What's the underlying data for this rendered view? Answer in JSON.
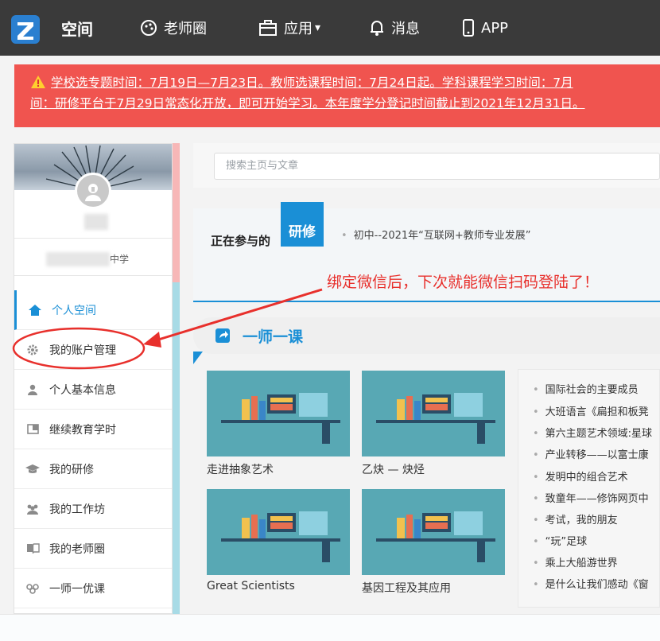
{
  "nav": {
    "brand": "空间",
    "items": [
      "老师圈",
      "应用",
      "消息",
      "APP"
    ],
    "apps_caret": "▾"
  },
  "alert": {
    "line1": "学校选专题时间：7月19日—7月23日。教师选课程时间：7月24日起。学科课程学习时间：7月",
    "line2": "间：研修平台于7月29日常态化开放，即可开始学习。本年度学分登记时间截止到2021年12月31日。"
  },
  "profile": {
    "school_suffix": "中学"
  },
  "menu": [
    {
      "label": "个人空间",
      "icon": "home-icon"
    },
    {
      "label": "我的账户管理",
      "icon": "gear-icon"
    },
    {
      "label": "个人基本信息",
      "icon": "user-icon"
    },
    {
      "label": "继续教育学时",
      "icon": "window-icon"
    },
    {
      "label": "我的研修",
      "icon": "grad-cap-icon"
    },
    {
      "label": "我的工作坊",
      "icon": "group-icon"
    },
    {
      "label": "我的老师圈",
      "icon": "book-icon"
    },
    {
      "label": "一师一优课",
      "icon": "people-icon"
    }
  ],
  "search": {
    "placeholder": "搜索主页与文章"
  },
  "join": {
    "label": "正在参与的",
    "badge": "研修",
    "item": "初中--2021年“互联网+教师专业发展”"
  },
  "annotation": "绑定微信后，下次就能微信扫码登陆了！",
  "course": {
    "title": "一师一课",
    "cards": [
      {
        "caption": "走进抽象艺术"
      },
      {
        "caption": "乙炔 — 炔烃"
      },
      {
        "caption": "Great Scientists"
      },
      {
        "caption": "基因工程及其应用"
      }
    ],
    "list": [
      "国际社会的主要成员",
      "大班语言《扁担和板凳",
      "第六主题艺术领域:星球",
      "产业转移——以富士康",
      "发明中的组合艺术",
      "致童年——修饰网页中",
      "考试，我的朋友",
      "“玩”足球",
      "乘上大船游世界",
      "是什么让我们感动《窗"
    ]
  },
  "colors": {
    "topbar": "#3a3a3a",
    "alert": "#f0544f",
    "accent": "#1a8fd6",
    "annotation": "#e8302c"
  }
}
